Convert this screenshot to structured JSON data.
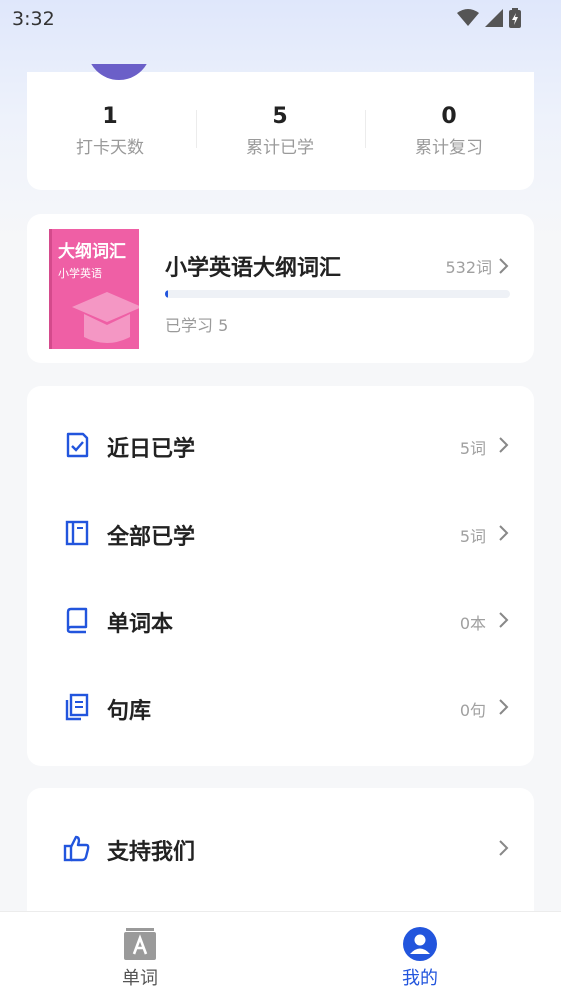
{
  "status_bar": {
    "time": "3:32"
  },
  "stats": [
    {
      "value": "1",
      "label": "打卡天数"
    },
    {
      "value": "5",
      "label": "累计已学"
    },
    {
      "value": "0",
      "label": "累计复习"
    }
  ],
  "book": {
    "cover_title": "大纲词汇",
    "cover_subtitle": "小学英语",
    "title": "小学英语大纲词汇",
    "count": "532词",
    "learned": "已学习 5",
    "progress_fraction": 0.0094
  },
  "menu": [
    {
      "label": "近日已学",
      "count": "5词",
      "icon": "checklist-icon"
    },
    {
      "label": "全部已学",
      "count": "5词",
      "icon": "notebook-icon"
    },
    {
      "label": "单词本",
      "count": "0本",
      "icon": "book-icon"
    },
    {
      "label": "句库",
      "count": "0句",
      "icon": "documents-icon"
    }
  ],
  "support": {
    "label": "支持我们",
    "icon": "thumbs-up-icon"
  },
  "tabs": [
    {
      "label": "单词",
      "active": false
    },
    {
      "label": "我的",
      "active": true
    }
  ],
  "colors": {
    "accent": "#2255dd",
    "cover": "#ef5fa5",
    "muted": "#a0a0a0"
  }
}
